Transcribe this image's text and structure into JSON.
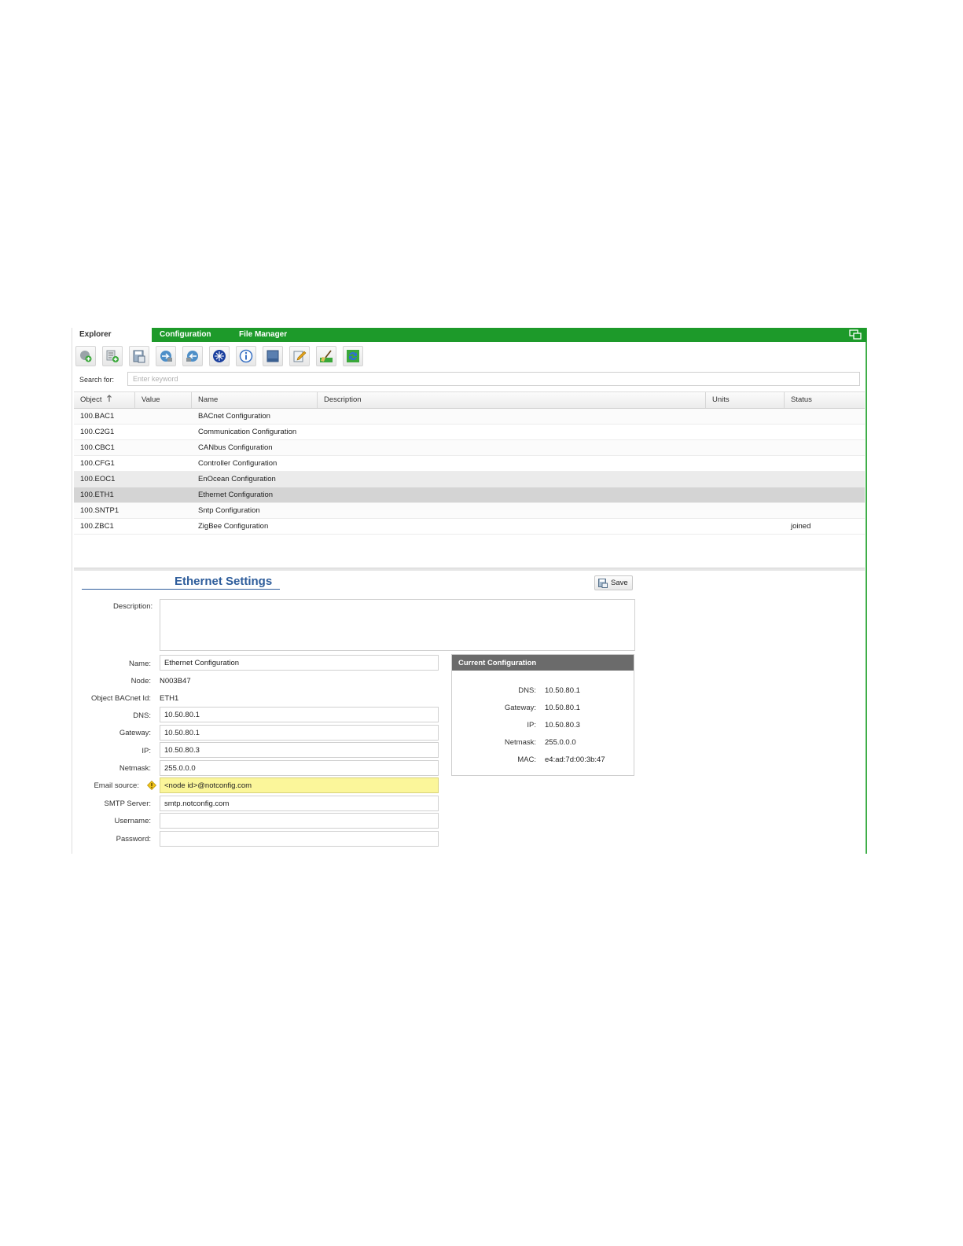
{
  "tabs": [
    {
      "label": "Explorer"
    },
    {
      "label": "Configuration"
    },
    {
      "label": "File Manager"
    }
  ],
  "toolbar": {
    "buttons": [
      {
        "icon": "add-object-icon"
      },
      {
        "icon": "add-list-icon"
      },
      {
        "icon": "save-disk-icon"
      },
      {
        "icon": "download-icon"
      },
      {
        "icon": "upload-icon"
      },
      {
        "icon": "network-icon"
      },
      {
        "icon": "info-icon"
      },
      {
        "icon": "panel-icon"
      },
      {
        "icon": "edit-icon"
      },
      {
        "icon": "clean-icon"
      },
      {
        "icon": "refresh-icon"
      }
    ]
  },
  "search": {
    "label": "Search for:",
    "placeholder": "Enter keyword"
  },
  "grid": {
    "columns": {
      "object": "Object",
      "value": "Value",
      "name": "Name",
      "description": "Description",
      "units": "Units",
      "status": "Status"
    },
    "rows": [
      {
        "object": "100.BAC1",
        "value": "",
        "name": "BACnet Configuration",
        "description": "",
        "units": "",
        "status": ""
      },
      {
        "object": "100.C2G1",
        "value": "",
        "name": "Communication Configuration",
        "description": "",
        "units": "",
        "status": ""
      },
      {
        "object": "100.CBC1",
        "value": "",
        "name": "CANbus Configuration",
        "description": "",
        "units": "",
        "status": ""
      },
      {
        "object": "100.CFG1",
        "value": "",
        "name": "Controller Configuration",
        "description": "",
        "units": "",
        "status": ""
      },
      {
        "object": "100.EOC1",
        "value": "",
        "name": "EnOcean Configuration",
        "description": "",
        "units": "",
        "status": ""
      },
      {
        "object": "100.ETH1",
        "value": "",
        "name": "Ethernet Configuration",
        "description": "",
        "units": "",
        "status": ""
      },
      {
        "object": "100.SNTP1",
        "value": "",
        "name": "Sntp Configuration",
        "description": "",
        "units": "",
        "status": ""
      },
      {
        "object": "100.ZBC1",
        "value": "",
        "name": "ZigBee Configuration",
        "description": "",
        "units": "",
        "status": "joined"
      }
    ]
  },
  "settings": {
    "title": "Ethernet Settings",
    "save_label": "Save",
    "labels": {
      "description": "Description:",
      "name": "Name:",
      "node": "Node:",
      "bacnet_id": "Object BACnet Id:",
      "dns": "DNS:",
      "gateway": "Gateway:",
      "ip": "IP:",
      "netmask": "Netmask:",
      "email_source": "Email source:",
      "smtp_server": "SMTP Server:",
      "username": "Username:",
      "password": "Password:"
    },
    "values": {
      "description": "",
      "name": "Ethernet Configuration",
      "node": "N003B47",
      "bacnet_id": "ETH1",
      "dns": "10.50.80.1",
      "gateway": "10.50.80.1",
      "ip": "10.50.80.3",
      "netmask": "255.0.0.0",
      "email_source": "<node id>@notconfig.com",
      "smtp_server": "smtp.notconfig.com",
      "username": "",
      "password": ""
    }
  },
  "current_config": {
    "title": "Current Configuration",
    "labels": {
      "dns": "DNS:",
      "gateway": "Gateway:",
      "ip": "IP:",
      "netmask": "Netmask:",
      "mac": "MAC:"
    },
    "values": {
      "dns": "10.50.80.1",
      "gateway": "10.50.80.1",
      "ip": "10.50.80.3",
      "netmask": "255.0.0.0",
      "mac": "e4:ad:7d:00:3b:47"
    }
  },
  "colors": {
    "tab_bar": "#1d9a2a",
    "title": "#2e5d9b",
    "highlight_field": "#fbf69a",
    "panel_header": "#6b6b6b"
  }
}
